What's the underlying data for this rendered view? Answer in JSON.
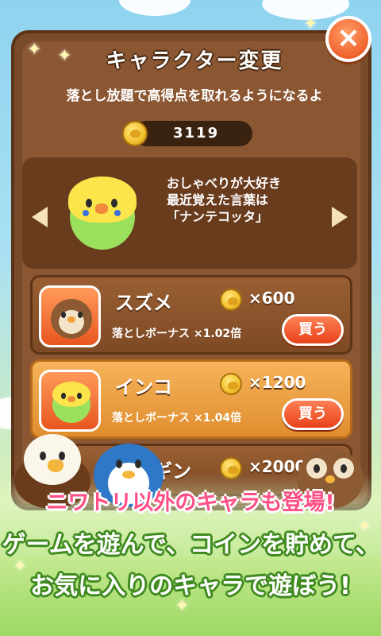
{
  "header": {
    "title": "キャラクター変更",
    "subtitle": "落とし放題で高得点を取れるようになるよ",
    "coins": "3119",
    "close_label": "×"
  },
  "preview": {
    "description_lines": [
      "おしゃべりが大好き",
      "最近覚えた言葉は",
      "「ナンテコッタ」"
    ],
    "prev_icon": "triangle-left",
    "next_icon": "triangle-right"
  },
  "characters": [
    {
      "name": "スズメ",
      "price": "×600",
      "bonus": "落としボーナス ×1.02倍",
      "buy_label": "買う"
    },
    {
      "name": "インコ",
      "price": "×1200",
      "bonus": "落としボーナス ×1.04倍",
      "buy_label": "買う"
    },
    {
      "name": "ペンギン",
      "price": "×2000"
    }
  ],
  "banner": {
    "line1": "ニワトリ以外のキャラも登場!",
    "line2": "ゲームを遊んで、コインを貯めて、",
    "line3": "お気に入りのキャラで遊ぼう!"
  },
  "colors": {
    "panel": "#7a4b2a",
    "accent": "#f0632c",
    "banner_pink": "#ff4f86",
    "banner_green": "#3f8a1f"
  }
}
